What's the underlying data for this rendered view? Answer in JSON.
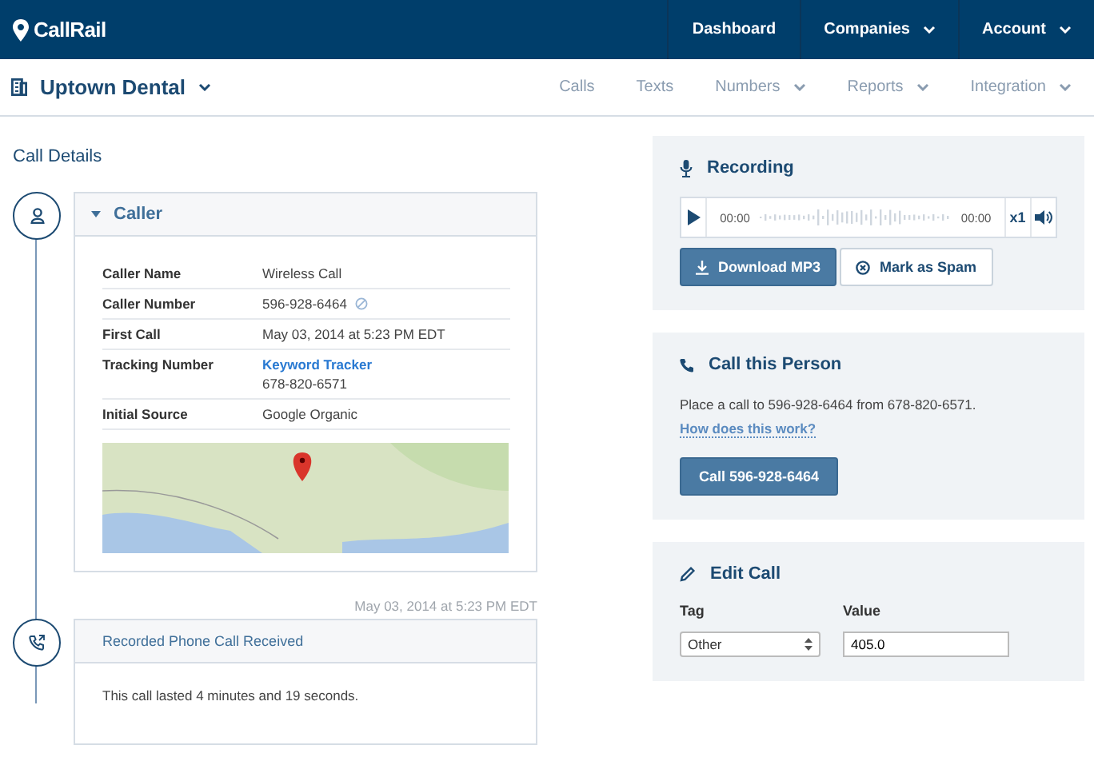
{
  "nav": {
    "logo": "CallRail",
    "items": [
      {
        "label": "Dashboard",
        "dropdown": false
      },
      {
        "label": "Companies",
        "dropdown": true
      },
      {
        "label": "Account",
        "dropdown": true
      }
    ]
  },
  "subnav": {
    "company": "Uptown Dental",
    "items": [
      {
        "label": "Calls",
        "dropdown": false
      },
      {
        "label": "Texts",
        "dropdown": false
      },
      {
        "label": "Numbers",
        "dropdown": true
      },
      {
        "label": "Reports",
        "dropdown": true
      },
      {
        "label": "Integration",
        "dropdown": true
      }
    ]
  },
  "page_title": "Call Details",
  "caller": {
    "title": "Caller",
    "expanded": true,
    "fields": [
      {
        "kind": "text",
        "label": "Caller Name",
        "value": "Wireless Call"
      },
      {
        "kind": "number",
        "label": "Caller Number",
        "value": "596-928-6464"
      },
      {
        "kind": "text",
        "label": "First Call",
        "value": "May 03, 2014 at 5:23 PM EDT"
      },
      {
        "kind": "tracking",
        "label": "Tracking Number",
        "link": "Keyword Tracker",
        "value": "678-820-6571"
      },
      {
        "kind": "text",
        "label": "Initial Source",
        "value": "Google Organic"
      }
    ]
  },
  "event": {
    "timestamp": "May 03, 2014 at 5:23 PM EDT",
    "title": "Recorded Phone Call Received",
    "body": "This call lasted 4 minutes and 19 seconds."
  },
  "recording": {
    "title": "Recording",
    "current_time": "00:00",
    "duration": "00:00",
    "speed": "x1",
    "buttons": [
      {
        "kind": "primary",
        "label": "Download MP3"
      },
      {
        "kind": "secondary",
        "label": "Mark as Spam"
      }
    ]
  },
  "call_person": {
    "title": "Call this Person",
    "text": "Place a call to 596-928-6464 from 678-820-6571.",
    "link": "How does this work?",
    "button": "Call 596-928-6464"
  },
  "edit_call": {
    "title": "Edit Call",
    "tag_label": "Tag",
    "tag_value": "Other",
    "value_label": "Value",
    "value": "405.0"
  }
}
